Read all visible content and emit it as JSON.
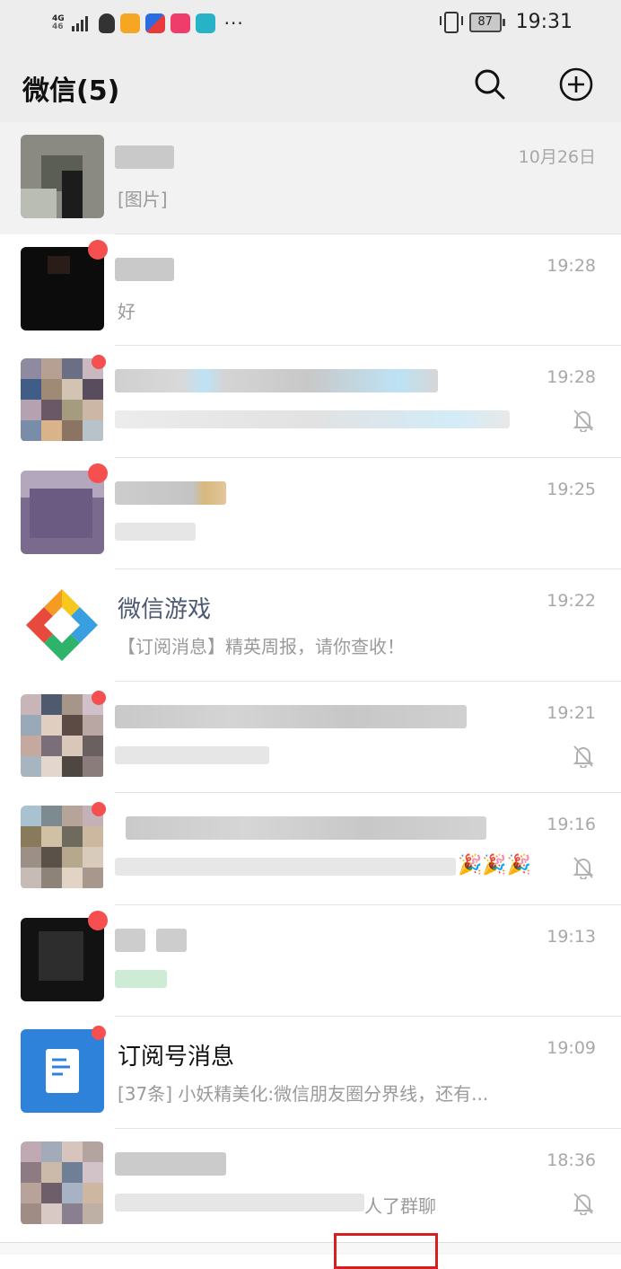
{
  "status_bar": {
    "network": "4G",
    "network_sub": "46",
    "battery": "87",
    "time": "19:31",
    "more": "···"
  },
  "header": {
    "title": "微信(5)",
    "search_icon": "search-icon",
    "add_icon": "plus-circle-icon"
  },
  "chats": [
    {
      "name": "",
      "preview": "[图片]",
      "time": "10月26日",
      "pinned": true,
      "badge": false,
      "muted": false
    },
    {
      "name": "",
      "preview": "好",
      "time": "19:28",
      "badge": true,
      "muted": false
    },
    {
      "name": "",
      "preview": "",
      "time": "19:28",
      "badge": true,
      "muted": true
    },
    {
      "name": "",
      "preview": "",
      "time": "19:25",
      "badge": true,
      "muted": false
    },
    {
      "name": "微信游戏",
      "preview": "【订阅消息】精英周报，请你查收！",
      "time": "19:22",
      "badge": false,
      "muted": false
    },
    {
      "name": "",
      "preview": "",
      "time": "19:21",
      "badge": true,
      "muted": true
    },
    {
      "name": "",
      "preview": "",
      "time": "19:16",
      "badge": true,
      "muted": true
    },
    {
      "name": "",
      "preview": "",
      "time": "19:13",
      "badge": true,
      "muted": false
    },
    {
      "name": "订阅号消息",
      "preview": "[37条] 小妖精美化:微信朋友圈分界线，还有...",
      "time": "19:09",
      "badge": true,
      "muted": false
    },
    {
      "name": "",
      "preview": "人了群聊",
      "time": "18:36",
      "badge": false,
      "muted": true
    }
  ],
  "colors": {
    "header_bg": "#ededed",
    "badge": "#f5504f",
    "time": "#a8a8a8",
    "preview": "#9a9a9a",
    "annotation_frame": "#d62020"
  }
}
